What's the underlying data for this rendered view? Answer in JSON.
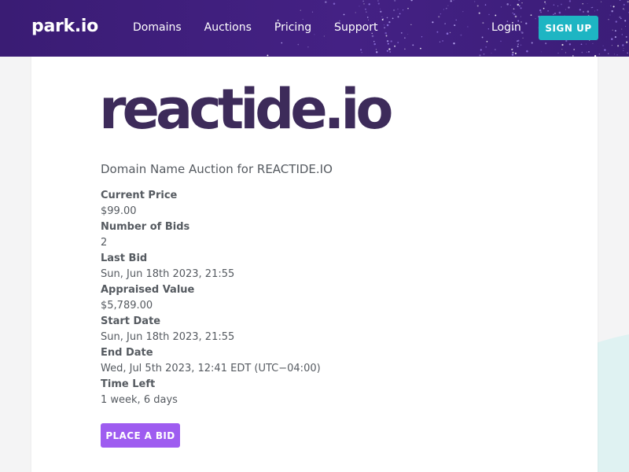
{
  "colors": {
    "nav_bg": "#3f1f7c",
    "signup_bg": "#1eb5c3",
    "bid_button_bg": "#9e5cf0",
    "title_color": "#3d2b5a",
    "text_color": "#555a60",
    "wave_color": "#dff2f2"
  },
  "header": {
    "logo": "park.io",
    "nav": [
      "Domains",
      "Auctions",
      "Pricing",
      "Support"
    ],
    "login": "Login",
    "signup": "SIGN UP"
  },
  "auction": {
    "domain": "reactide.io",
    "subtitle": "Domain Name Auction for REACTIDE.IO",
    "details": [
      {
        "label": "Current Price",
        "value": "$99.00"
      },
      {
        "label": "Number of Bids",
        "value": "2"
      },
      {
        "label": "Last Bid",
        "value": "Sun, Jun 18th 2023, 21:55"
      },
      {
        "label": "Appraised Value",
        "value": "$5,789.00"
      },
      {
        "label": "Start Date",
        "value": "Sun, Jun 18th 2023, 21:55"
      },
      {
        "label": "End Date",
        "value": "Wed, Jul 5th 2023, 12:41 EDT (UTC−04:00)"
      },
      {
        "label": "Time Left",
        "value": "1 week, 6 days"
      }
    ],
    "button": "PLACE A BID"
  }
}
